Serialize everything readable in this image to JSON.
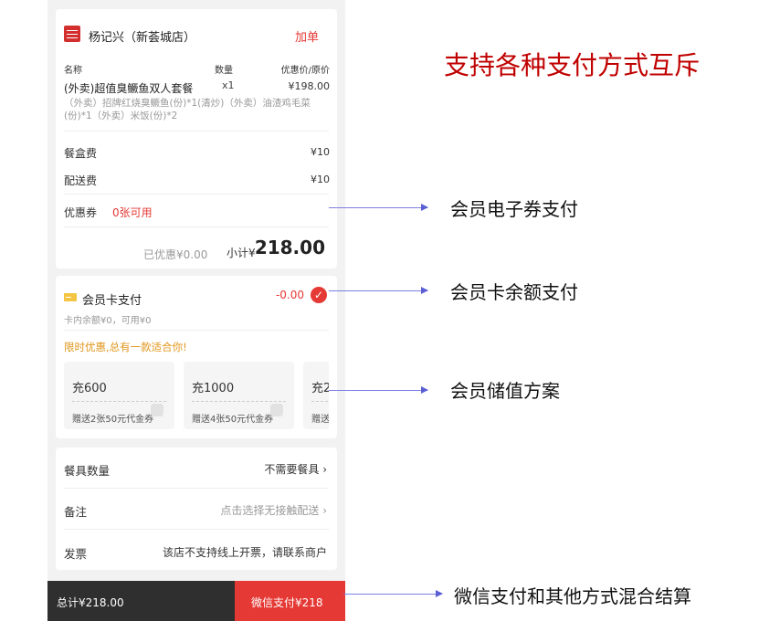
{
  "order": {
    "store_name": "杨记兴（新荟城店）",
    "add_label": "加单",
    "header_name": "名称",
    "header_qty": "数量",
    "header_price": "优惠价/原价",
    "item_name": "(外卖)超值臭鳜鱼双人套餐",
    "item_qty": "x1",
    "item_price": "¥198.00",
    "item_desc": "（外卖）招牌红烧臭鳜鱼(份)*1(清炒)（外卖）油渣鸡毛菜(份)*1（外卖）米饭(份)*2",
    "box_fee_label": "餐盒费",
    "box_fee_value": "¥10",
    "delivery_fee_label": "配送费",
    "delivery_fee_value": "¥10",
    "coupon_label": "优惠券",
    "coupon_value": "0张可用",
    "discounted": "已优惠¥0.00",
    "subtotal_label": "小计¥",
    "subtotal_value": "218.00"
  },
  "member": {
    "title": "会员卡支付",
    "amount": "-0.00",
    "check_icon": "✓",
    "balance": "卡内余额¥0，可用¥0",
    "promo": "限时优惠,总有一款适合你!",
    "plans": [
      {
        "title": "充600",
        "sub": "赠送2张50元代金券"
      },
      {
        "title": "充1000",
        "sub": "赠送4张50元代金券"
      },
      {
        "title": "充2",
        "sub": "赠送"
      }
    ]
  },
  "options": {
    "utensils_label": "餐具数量",
    "utensils_value": "不需要餐具",
    "note_label": "备注",
    "note_value": "点击选择无接触配送",
    "invoice_label": "发票",
    "invoice_value": "该店不支持线上开票，请联系商户"
  },
  "footer": {
    "total": "总计¥218.00",
    "pay_button": "微信支付¥218"
  },
  "annotations": {
    "title": "支持各种支付方式互斥",
    "coupon": "会员电子券支付",
    "card": "会员卡余额支付",
    "recharge": "会员储值方案",
    "mixed": "微信支付和其他方式混合结算"
  },
  "colors": {
    "accent": "#e53935",
    "promo": "#e0961a",
    "annotation_title": "#c00000",
    "arrow": "#7b7fe0"
  }
}
